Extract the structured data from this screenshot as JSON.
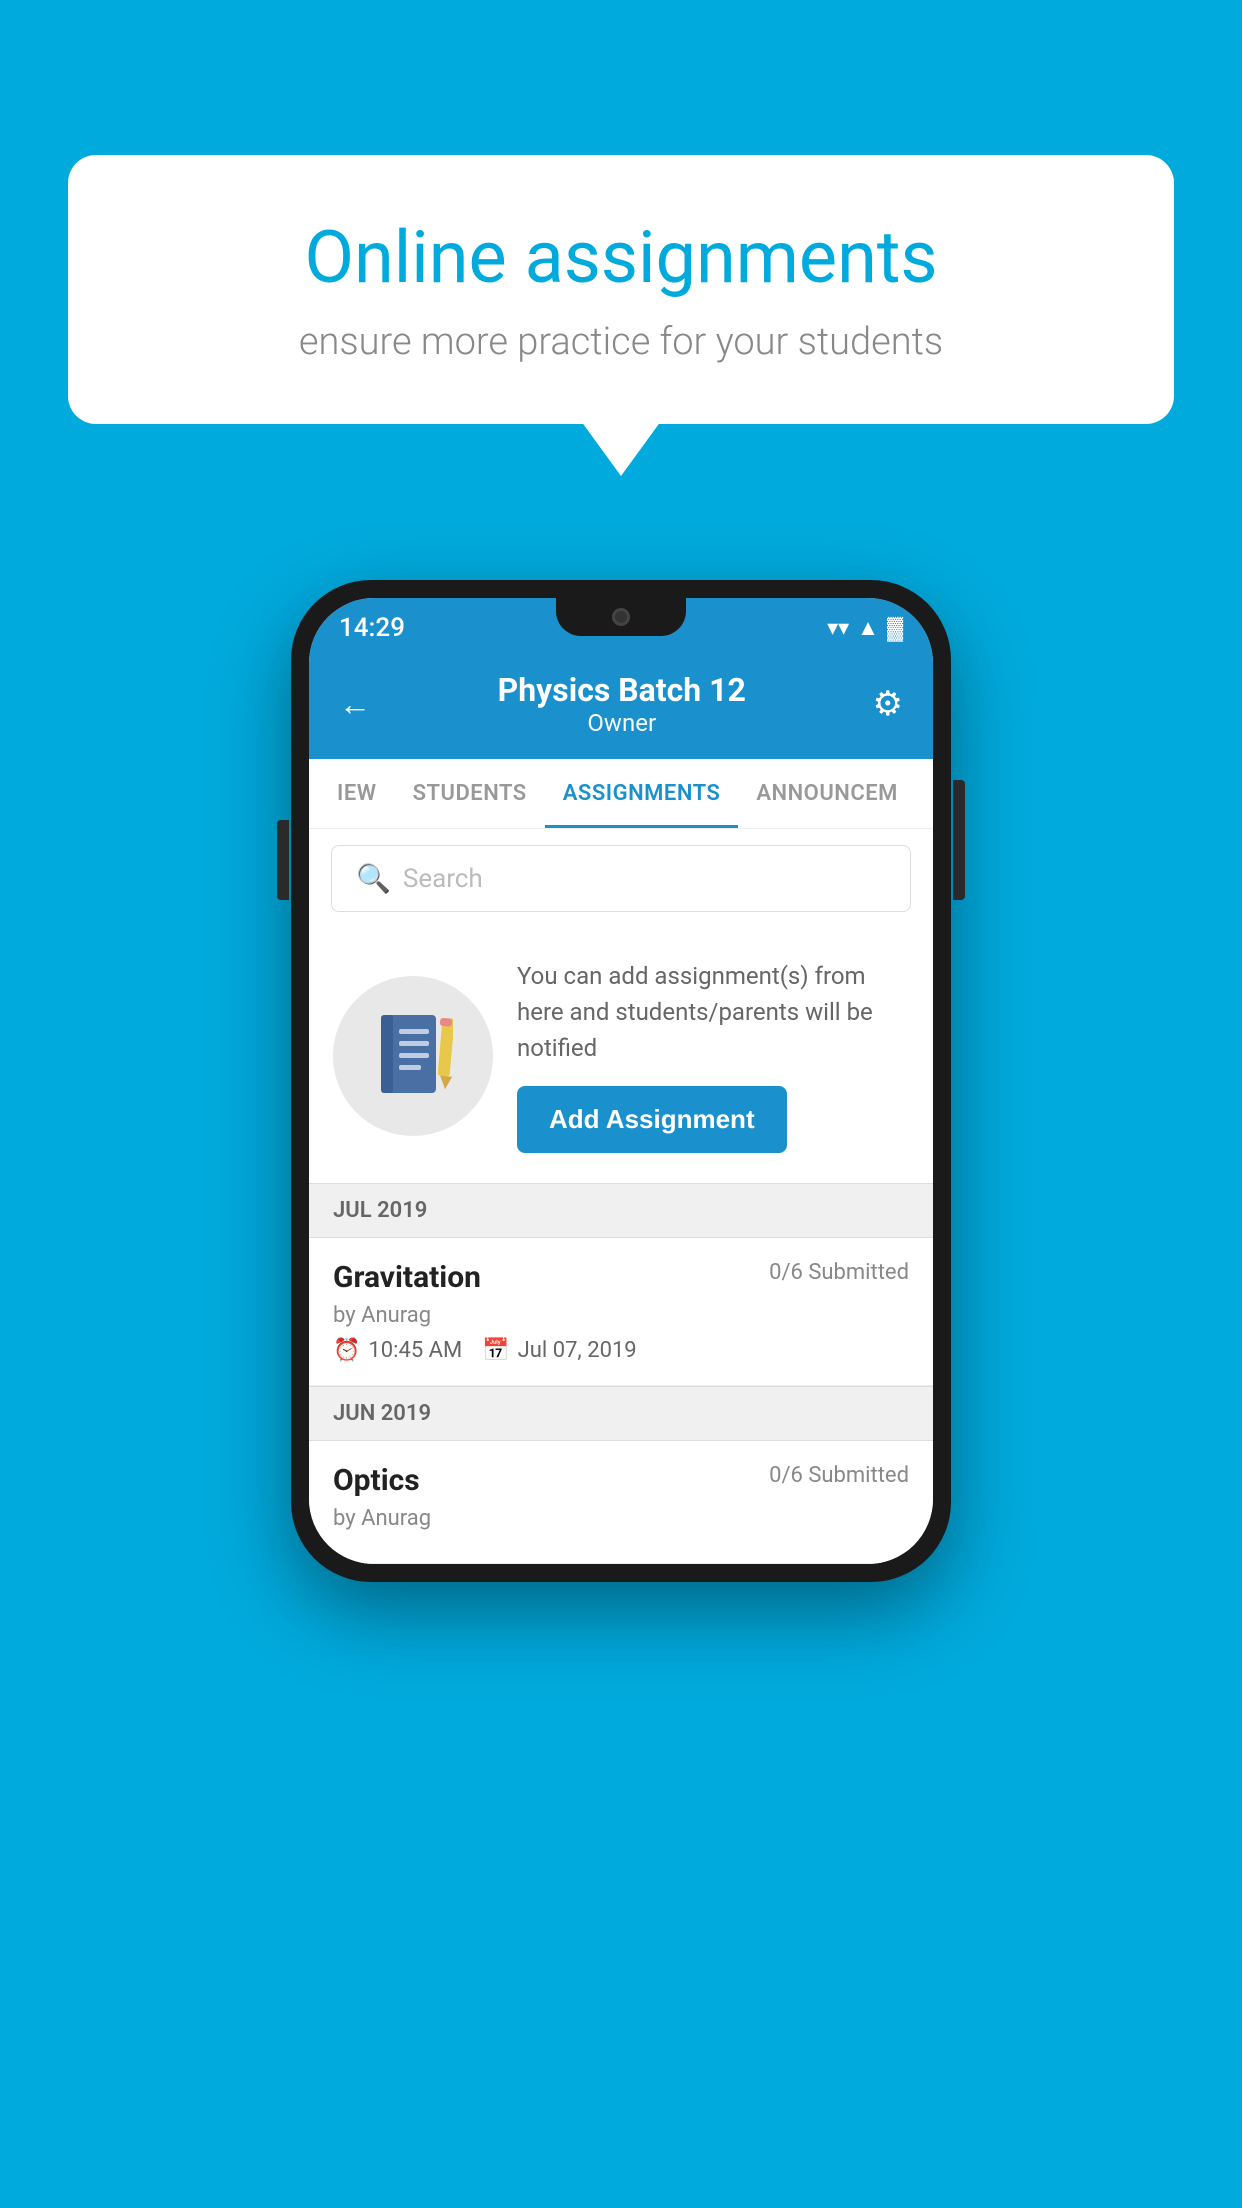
{
  "background_color": "#00AADD",
  "speech_bubble": {
    "title": "Online assignments",
    "subtitle": "ensure more practice for your students"
  },
  "status_bar": {
    "time": "14:29",
    "wifi": "▼",
    "signal": "▲",
    "battery": "▓"
  },
  "header": {
    "title": "Physics Batch 12",
    "subtitle": "Owner",
    "back_label": "←",
    "gear_label": "⚙"
  },
  "tabs": [
    {
      "label": "IEW",
      "active": false
    },
    {
      "label": "STUDENTS",
      "active": false
    },
    {
      "label": "ASSIGNMENTS",
      "active": true
    },
    {
      "label": "ANNOUNCEM",
      "active": false
    }
  ],
  "search": {
    "placeholder": "Search"
  },
  "assignment_prompt": {
    "description": "You can add assignment(s) from here and students/parents will be notified",
    "button_label": "Add Assignment"
  },
  "sections": [
    {
      "label": "JUL 2019",
      "assignments": [
        {
          "name": "Gravitation",
          "submitted": "0/6 Submitted",
          "author": "by Anurag",
          "time": "10:45 AM",
          "date": "Jul 07, 2019"
        }
      ]
    },
    {
      "label": "JUN 2019",
      "assignments": [
        {
          "name": "Optics",
          "submitted": "0/6 Submitted",
          "author": "by Anurag",
          "time": "",
          "date": ""
        }
      ]
    }
  ]
}
